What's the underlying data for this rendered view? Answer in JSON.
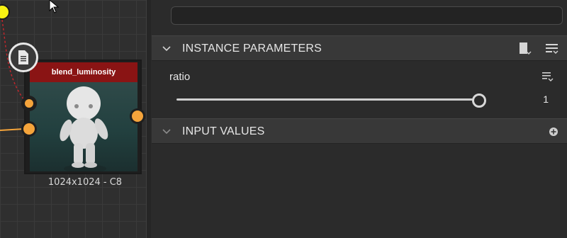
{
  "graph": {
    "node": {
      "title": "blend_luminosity",
      "caption": "1024x1024 - C8"
    },
    "colors": {
      "node_header": "#8a1414",
      "port": "#f5a43b",
      "connection_active": "#f5a43b",
      "connection_dashed": "#c0262c",
      "output_dot": "#f7f212"
    },
    "icons": [
      "document-icon",
      "mouse-cursor-icon"
    ]
  },
  "panel": {
    "search": {
      "value": "",
      "placeholder": ""
    },
    "sections": [
      {
        "label": "INSTANCE PARAMETERS",
        "expanded": true,
        "icons": [
          "bookmark-preset-icon",
          "list-menu-icon"
        ]
      },
      {
        "label": "INPUT VALUES",
        "expanded": true,
        "icons": [
          "add-circle-icon"
        ]
      }
    ],
    "parameters": [
      {
        "label": "ratio",
        "value": "1",
        "slider_fraction": 1.0
      }
    ]
  }
}
